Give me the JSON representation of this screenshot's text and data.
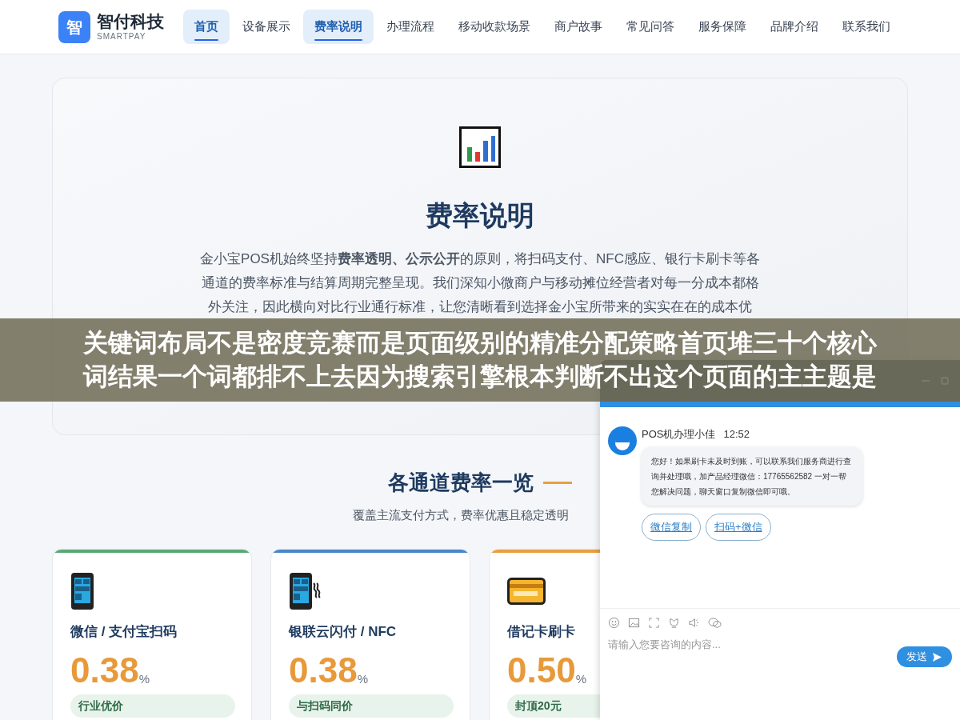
{
  "nav": {
    "logo_mark": "智",
    "brand": "智付科技",
    "brand_sub": "SMARTPAY",
    "items": [
      {
        "label": "首页",
        "selected": true
      },
      {
        "label": "设备展示",
        "selected": false
      },
      {
        "label": "费率说明",
        "selected": true
      },
      {
        "label": "办理流程",
        "selected": false
      },
      {
        "label": "移动收款场景",
        "selected": false
      },
      {
        "label": "商户故事",
        "selected": false
      },
      {
        "label": "常见问答",
        "selected": false
      },
      {
        "label": "服务保障",
        "selected": false
      },
      {
        "label": "品牌介绍",
        "selected": false
      },
      {
        "label": "联系我们",
        "selected": false
      }
    ]
  },
  "hero": {
    "title": "费率说明",
    "paragraph": "金小宝POS机始终坚持**费率透明、公示公开**的原则，将扫码支付、NFC感应、银行卡刷卡等各通道的费率标准与结算周期完整呈现。我们深知小微商户与移动摊位经营者对每一分成本都格外关注，因此横向对比行业通行标准，让您清晰看到选择金小宝所带来的实实在在的成本优"
  },
  "section": {
    "title": "各通道费率一览",
    "subtitle": "覆盖主流支付方式，费率优惠且稳定透明"
  },
  "cards": [
    {
      "kind": "phone",
      "title": "微信 / 支付宝扫码",
      "rate": "0.38",
      "unit": "%",
      "tag": "行业优价",
      "color": "#5aa877"
    },
    {
      "kind": "nfc",
      "title": "银联云闪付 / NFC",
      "rate": "0.38",
      "unit": "%",
      "tag": "与扫码同价",
      "color": "#4a86c8"
    },
    {
      "kind": "card",
      "title": "借记卡刷卡",
      "rate": "0.50",
      "unit": "%",
      "tag": "封顶20元",
      "color": "#e8a040"
    }
  ],
  "chat": {
    "agent": "POS机办理小佳",
    "time": "12:52",
    "message": "您好！如果刷卡未及时到账，可以联系我们服务商进行查询并处理哦，加产品经理微信：17765562582 一对一帮您解决问题，聊天窗口复制微信即可哦。",
    "actions": [
      "微信复制",
      "扫码+微信"
    ],
    "placeholder": "请输入您要咨询的内容...",
    "send": "发送"
  },
  "overlay_banner": {
    "lines": [
      "关键词布局不是密度竞赛而是页面级别的精准分配策略首页堆三十个核心",
      "词结果一个词都排不上去因为搜索引擎根本判断不出这个页面的主主题是"
    ]
  }
}
